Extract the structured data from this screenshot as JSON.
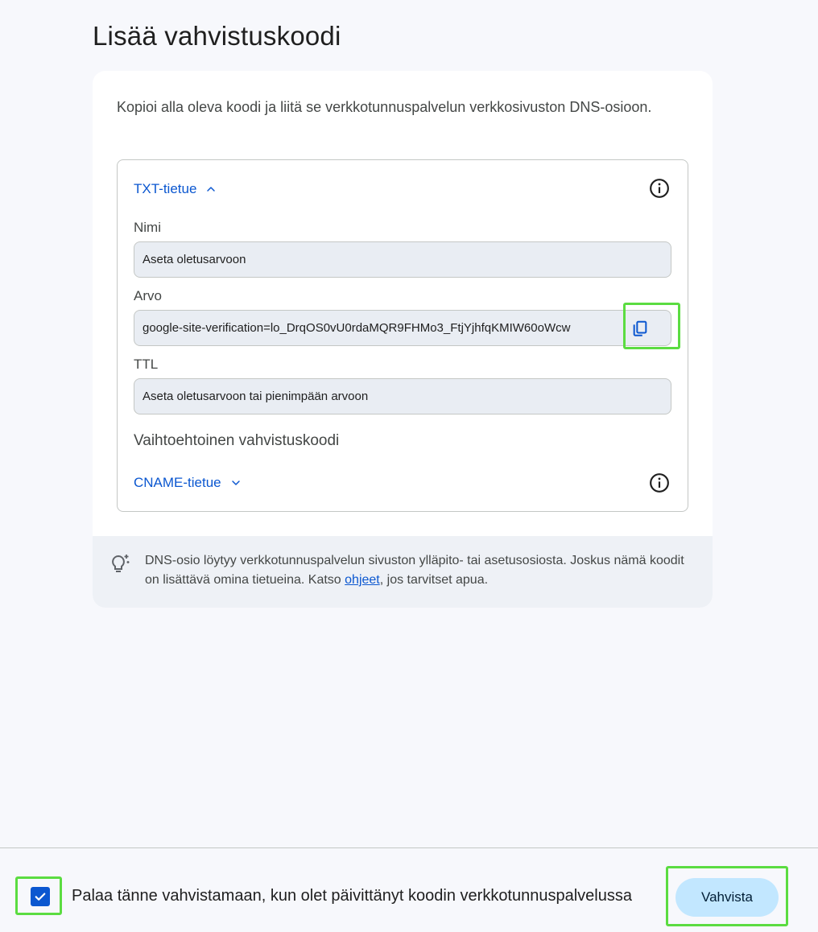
{
  "page": {
    "title": "Lisää vahvistuskoodi",
    "intro": "Kopioi alla oleva koodi ja liitä se verkkotunnuspalvelun verkkosivuston DNS-osioon."
  },
  "txt_record": {
    "header": "TXT-tietue",
    "expanded": true,
    "name_label": "Nimi",
    "name_value": "Aseta oletusarvoon",
    "value_label": "Arvo",
    "value_value": "google-site-verification=lo_DrqOS0vU0rdaMQR9FHMo3_FtjYjhfqKMIW60oWcw",
    "ttl_label": "TTL",
    "ttl_value": "Aseta oletusarvoon tai pienimpään arvoon"
  },
  "alternative": {
    "label": "Vaihtoehtoinen vahvistuskoodi",
    "cname_header": "CNAME-tietue",
    "expanded": false
  },
  "tip": {
    "text_before": "DNS-osio löytyy verkkotunnuspalvelun sivuston ylläpito- tai asetusosiosta. Joskus nämä koodit on lisättävä omina tietueina. Katso ",
    "link": "ohjeet",
    "text_after": ", jos tarvitset apua."
  },
  "footer": {
    "checkbox_checked": true,
    "checkbox_label": "Palaa tänne vahvistamaan, kun olet päivittänyt koodin verkkotunnuspalvelussa",
    "verify_button": "Vahvista"
  },
  "colors": {
    "accent": "#0b57d0",
    "highlight": "#5bdc41",
    "field_bg": "#e9edf3",
    "button_bg": "#c2e7ff"
  }
}
